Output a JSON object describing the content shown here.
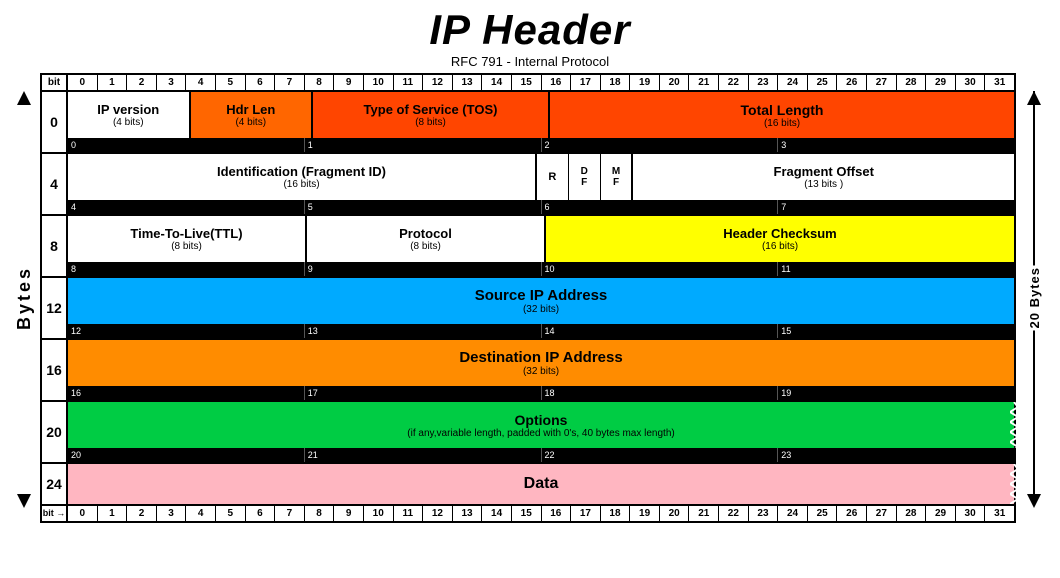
{
  "title": "IP Header",
  "subtitle": "RFC 791 - Internal Protocol",
  "bits": [
    "0",
    "1",
    "2",
    "3",
    "4",
    "5",
    "6",
    "7",
    "8",
    "9",
    "10",
    "11",
    "12",
    "13",
    "14",
    "15",
    "16",
    "17",
    "18",
    "19",
    "20",
    "21",
    "22",
    "23",
    "24",
    "25",
    "26",
    "27",
    "28",
    "29",
    "30",
    "31"
  ],
  "bytes_label": "Bytes",
  "twenty_bytes": "20 Bytes",
  "rows": [
    {
      "byte": "0",
      "fields": [
        {
          "label": "IP version",
          "bits": "(4 bits)",
          "color": "white",
          "span": 4
        },
        {
          "label": "Hdr Len",
          "bits": "(4 bits)",
          "color": "orange",
          "span": 4
        },
        {
          "label": "Type of Service (TOS)",
          "bits": "(8 bits)",
          "color": "red-orange",
          "span": 8
        },
        {
          "label": "Total Length",
          "bits": "(16 bits)",
          "color": "red-orange2",
          "span": 16
        }
      ],
      "bottom_nums": [
        "0",
        "1",
        "2",
        "3"
      ]
    },
    {
      "byte": "4",
      "fields": [
        {
          "label": "Identification (Fragment ID)",
          "bits": "(16 bits)",
          "color": "white",
          "span": 16
        },
        {
          "label": "R",
          "bits": "",
          "color": "white",
          "span": 1
        },
        {
          "label": "D\nF",
          "bits": "",
          "color": "white",
          "span": 1
        },
        {
          "label": "M\nF",
          "bits": "",
          "color": "white",
          "span": 1
        },
        {
          "label": "Fragment Offset",
          "bits": "(13 bits)",
          "color": "white",
          "span": 13
        }
      ],
      "bottom_nums": [
        "4",
        "5",
        "6",
        "7"
      ]
    },
    {
      "byte": "8",
      "fields": [
        {
          "label": "Time-To-Live(TTL)",
          "bits": "(8 bits)",
          "color": "white",
          "span": 8
        },
        {
          "label": "Protocol",
          "bits": "(8 bits)",
          "color": "white",
          "span": 8
        },
        {
          "label": "Header Checksum",
          "bits": "(16 bits)",
          "color": "yellow",
          "span": 16
        }
      ],
      "bottom_nums": [
        "8",
        "9",
        "10",
        "11"
      ]
    },
    {
      "byte": "12",
      "fields": [
        {
          "label": "Source IP Address",
          "bits": "(32 bits)",
          "color": "blue",
          "span": 32
        }
      ],
      "bottom_nums": [
        "12",
        "13",
        "14",
        "15"
      ]
    },
    {
      "byte": "16",
      "fields": [
        {
          "label": "Destination IP Address",
          "bits": "(32 bits)",
          "color": "orange2",
          "span": 32
        }
      ],
      "bottom_nums": [
        "16",
        "17",
        "18",
        "19"
      ]
    },
    {
      "byte": "20",
      "fields": [
        {
          "label": "Options",
          "bits": "(if any,variable length, padded with 0's, 40 bytes max length)",
          "color": "green",
          "span": 32
        }
      ],
      "bottom_nums": [
        "20",
        "21",
        "22",
        "23"
      ]
    },
    {
      "byte": "24",
      "fields": [
        {
          "label": "Data",
          "bits": "",
          "color": "pink",
          "span": 32
        }
      ],
      "bottom_nums": []
    }
  ],
  "bit_label": "bit",
  "bit_label_bottom": "bit →"
}
